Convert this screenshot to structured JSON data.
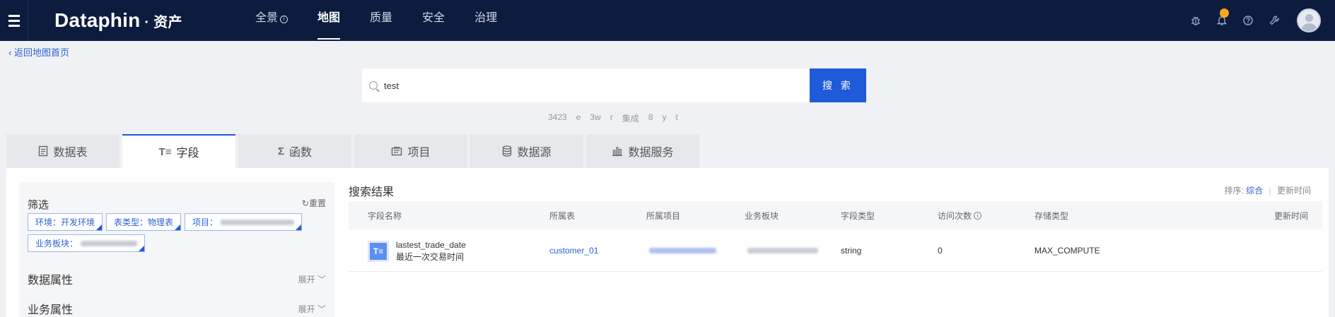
{
  "app": {
    "brand": "Dataphin",
    "brand_separator": "·",
    "brand_sub": "资产"
  },
  "nav": [
    {
      "label": "全景",
      "active": false
    },
    {
      "label": "地图",
      "active": true
    },
    {
      "label": "质量",
      "active": false
    },
    {
      "label": "安全",
      "active": false
    },
    {
      "label": "治理",
      "active": false
    }
  ],
  "back_link": "返回地图首页",
  "search": {
    "value": "test",
    "button_label": "搜 索",
    "suggestions": [
      "3423",
      "e",
      "3w",
      "r",
      "集成",
      "8",
      "y",
      "t"
    ]
  },
  "tabs": [
    {
      "label": "数据表",
      "icon": "document-icon"
    },
    {
      "label": "字段",
      "icon": "field-icon",
      "active": true
    },
    {
      "label": "函数",
      "icon": "sigma-icon"
    },
    {
      "label": "项目",
      "icon": "project-icon"
    },
    {
      "label": "数据源",
      "icon": "database-icon"
    },
    {
      "label": "数据服务",
      "icon": "bar-chart-icon"
    }
  ],
  "filter": {
    "title": "筛选",
    "reset_label": "重置",
    "chips": [
      {
        "label": "环境：开发环境"
      },
      {
        "label": "表类型：物理表"
      },
      {
        "label": "项目："
      },
      {
        "label": "业务板块："
      }
    ],
    "sections": [
      {
        "label": "数据属性",
        "expand": "展开"
      },
      {
        "label": "业务属性",
        "expand": "展开"
      }
    ]
  },
  "results": {
    "title": "搜索结果",
    "sort_label": "排序:",
    "sort_options": [
      "综合",
      "更新时间"
    ],
    "columns": [
      "字段名称",
      "所属表",
      "所属项目",
      "业务板块",
      "字段类型",
      "访问次数",
      "存储类型",
      "更新时间"
    ],
    "rows": [
      {
        "icon_text": "T≡",
        "name": "lastest_trade_date",
        "description": "最近一次交易时间",
        "table": "customer_01",
        "field_type": "string",
        "visits": "0",
        "storage": "MAX_COMPUTE"
      }
    ]
  }
}
